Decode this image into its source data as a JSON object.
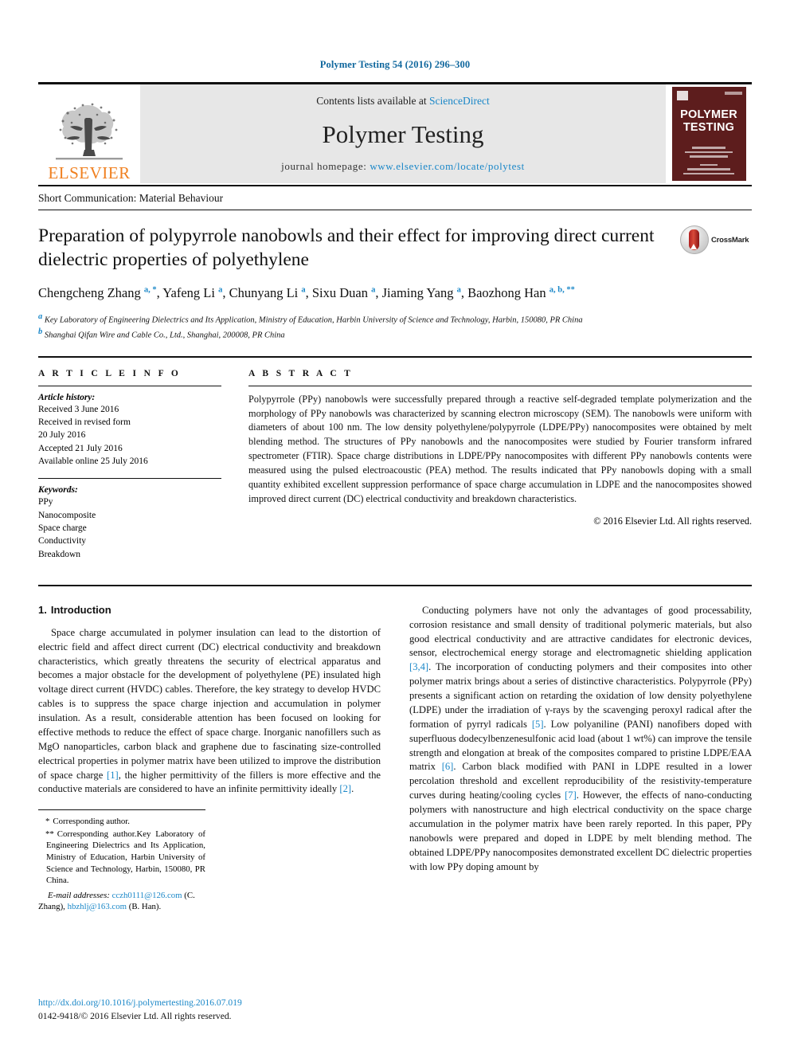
{
  "running_head": "Polymer Testing 54 (2016) 296–300",
  "banner": {
    "publisher": "ELSEVIER",
    "contents_prefix": "Contents lists available at ",
    "contents_link": "ScienceDirect",
    "journal_name": "Polymer Testing",
    "homepage_prefix": "journal homepage: ",
    "homepage_url": "www.elsevier.com/locate/polytest",
    "cover_title_line1": "POLYMER",
    "cover_title_line2": "TESTING"
  },
  "article_type": "Short Communication: Material Behaviour",
  "title": "Preparation of polypyrrole nanobowls and their effect for improving direct current dielectric properties of polyethylene",
  "crossmark_label": "CrossMark",
  "authors": [
    {
      "name": "Chengcheng Zhang",
      "marks": "a, *"
    },
    {
      "name": "Yafeng Li",
      "marks": "a"
    },
    {
      "name": "Chunyang Li",
      "marks": "a"
    },
    {
      "name": "Sixu Duan",
      "marks": "a"
    },
    {
      "name": "Jiaming Yang",
      "marks": "a"
    },
    {
      "name": "Baozhong Han",
      "marks": "a, b, **"
    }
  ],
  "affiliations": [
    {
      "mark": "a",
      "text": "Key Laboratory of Engineering Dielectrics and Its Application, Ministry of Education, Harbin University of Science and Technology, Harbin, 150080, PR China"
    },
    {
      "mark": "b",
      "text": "Shanghai Qifan Wire and Cable Co., Ltd., Shanghai, 200008, PR China"
    }
  ],
  "article_info": {
    "heading": "A R T I C L E   I N F O",
    "history_label": "Article history:",
    "history": [
      "Received 3 June 2016",
      "Received in revised form",
      "20 July 2016",
      "Accepted 21 July 2016",
      "Available online 25 July 2016"
    ],
    "keywords_label": "Keywords:",
    "keywords": [
      "PPy",
      "Nanocomposite",
      "Space charge",
      "Conductivity",
      "Breakdown"
    ]
  },
  "abstract": {
    "heading": "A B S T R A C T",
    "text": "Polypyrrole (PPy) nanobowls were successfully prepared through a reactive self-degraded template polymerization and the morphology of PPy nanobowls was characterized by scanning electron microscopy (SEM). The nanobowls were uniform with diameters of about 100 nm. The low density polyethylene/polypyrrole (LDPE/PPy) nanocomposites were obtained by melt blending method. The structures of PPy nanobowls and the nanocomposites were studied by Fourier transform infrared spectrometer (FTIR). Space charge distributions in LDPE/PPy nanocomposites with different PPy nanobowls contents were measured using the pulsed electroacoustic (PEA) method. The results indicated that PPy nanobowls doping with a small quantity exhibited excellent suppression performance of space charge accumulation in LDPE and the nanocomposites showed improved direct current (DC) electrical conductivity and breakdown characteristics.",
    "copyright": "© 2016 Elsevier Ltd. All rights reserved."
  },
  "body": {
    "section_number": "1.",
    "section_title": "Introduction",
    "left_paragraph_1": "Space charge accumulated in polymer insulation can lead to the distortion of electric field and affect direct current (DC) electrical conductivity and breakdown characteristics, which greatly threatens the security of electrical apparatus and becomes a major obstacle for the development of polyethylene (PE) insulated high voltage direct current (HVDC) cables. Therefore, the key strategy to develop HVDC cables is to suppress the space charge injection and accumulation in polymer insulation. As a result, considerable attention has been focused on looking for effective methods to reduce the effect of space charge. Inorganic nanofillers such as MgO nanoparticles, carbon black and graphene due to fascinating size-controlled electrical properties in polymer matrix have been utilized to improve the distribution of space charge ",
    "left_ref_1": "[1]",
    "left_paragraph_1_cont": ", the higher permittivity of the fillers is more effective and the conductive materials are considered to have an infinite permittivity ideally ",
    "left_ref_2": "[2]",
    "left_paragraph_1_end": ".",
    "right_part_1": "Conducting polymers have not only the advantages of good processability, corrosion resistance and small density of traditional polymeric materials, but also good electrical conductivity and are attractive candidates for electronic devices, sensor, electrochemical energy storage and electromagnetic shielding application ",
    "right_ref_1": "[3,4]",
    "right_part_2": ". The incorporation of conducting polymers and their composites into other polymer matrix brings about a series of distinctive characteristics. Polypyrrole (PPy) presents a significant action on retarding the oxidation of low density polyethylene (LDPE) under the irradiation of γ-rays by the scavenging peroxyl radical after the formation of pyrryl radicals ",
    "right_ref_2": "[5]",
    "right_part_3": ". Low polyaniline (PANI) nanofibers doped with superfluous dodecylbenzenesulfonic acid load (about 1 wt%) can improve the tensile strength and elongation at break of the composites compared to pristine LDPE/EAA matrix ",
    "right_ref_3": "[6]",
    "right_part_4": ". Carbon black modified with PANI in LDPE resulted in a lower percolation threshold and excellent reproducibility of the resistivity-temperature curves during heating/cooling cycles ",
    "right_ref_4": "[7]",
    "right_part_5": ". However, the effects of nano-conducting polymers with nanostructure and high electrical conductivity on the space charge accumulation in the polymer matrix have been rarely reported. In this paper, PPy nanobowls were prepared and doped in LDPE by melt blending method. The obtained LDPE/PPy nanocomposites demonstrated excellent DC dielectric properties with low PPy doping amount by"
  },
  "footnotes": {
    "fn1_mark": "*",
    "fn1_text": "Corresponding author.",
    "fn2_mark": "**",
    "fn2_text": "Corresponding author.Key Laboratory of Engineering Dielectrics and Its Application, Ministry of Education, Harbin University of Science and Technology, Harbin, 150080, PR China.",
    "email_label": "E-mail addresses:",
    "email1": "cczh0111@126.com",
    "email1_owner": "(C. Zhang),",
    "email2": "hbzhlj@163.com",
    "email2_owner": "(B. Han)."
  },
  "footer": {
    "doi": "http://dx.doi.org/10.1016/j.polymertesting.2016.07.019",
    "issn": "0142-9418/© 2016 Elsevier Ltd. All rights reserved."
  },
  "colors": {
    "link": "#1a87c8",
    "elsevier_orange": "#f08020",
    "cover_maroon": "#5d1d1d",
    "running_head": "#11689e"
  }
}
